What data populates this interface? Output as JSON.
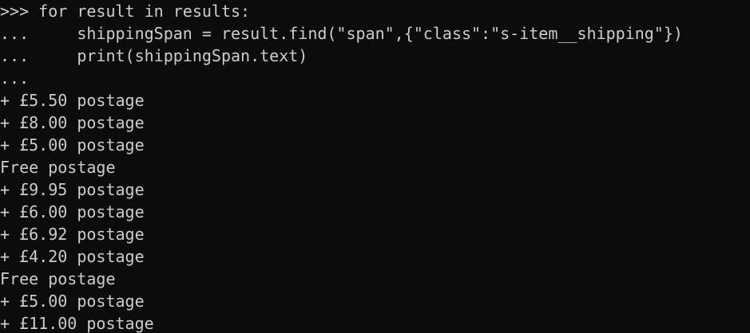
{
  "terminal": {
    "background": "#0c0c0c",
    "foreground": "#cccccc",
    "lines": [
      ">>> for result in results:",
      "...     shippingSpan = result.find(\"span\",{\"class\":\"s-item__shipping\"})",
      "...     print(shippingSpan.text)",
      "...",
      "+ £5.50 postage",
      "+ £8.00 postage",
      "+ £5.00 postage",
      "Free postage",
      "+ £9.95 postage",
      "+ £6.00 postage",
      "+ £6.92 postage",
      "+ £4.20 postage",
      "Free postage",
      "+ £5.00 postage",
      "+ £11.00 postage"
    ]
  }
}
